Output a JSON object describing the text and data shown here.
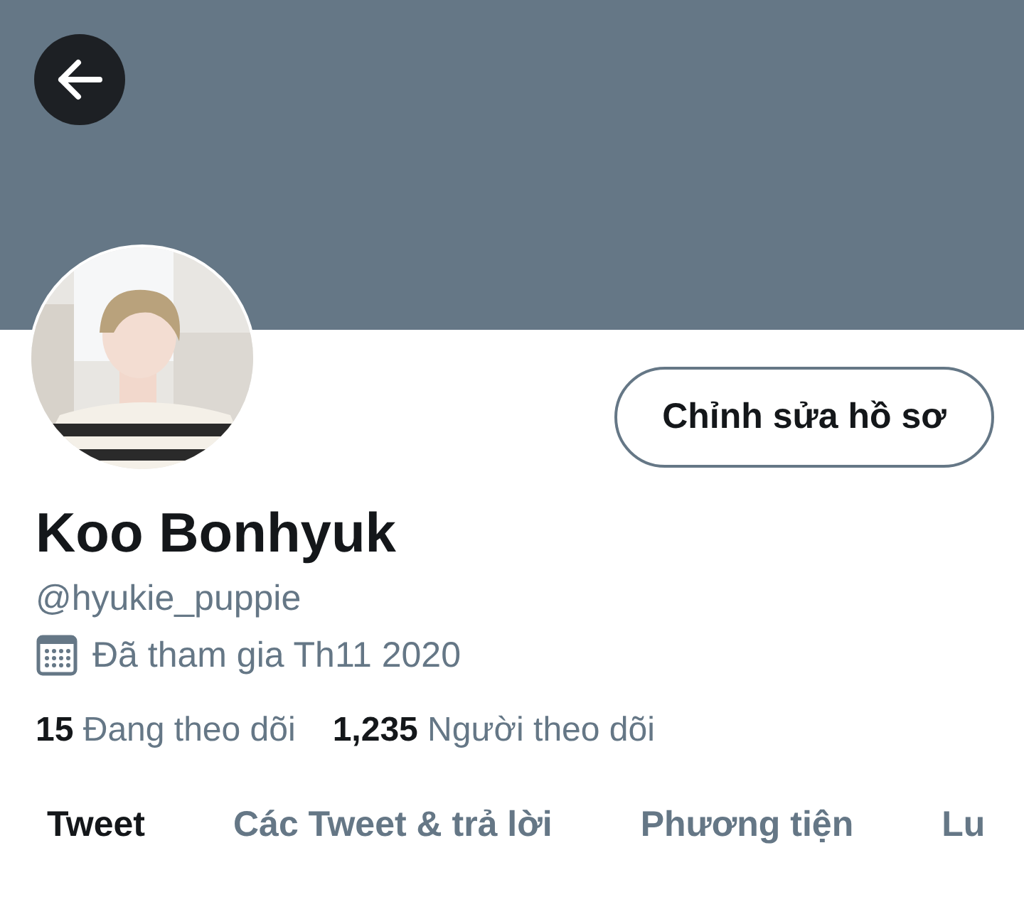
{
  "profile": {
    "name": "Koo Bonhyuk",
    "handle": "@hyukie_puppie",
    "joined": "Đã tham gia Th11 2020"
  },
  "edit_button": {
    "label": "Chỉnh sửa hồ sơ"
  },
  "stats": [
    {
      "count": "15",
      "label": "Đang theo dõi"
    },
    {
      "count": "1,235",
      "label": "Người theo dõi"
    }
  ],
  "tabs": [
    {
      "label": "Tweet",
      "selected": true
    },
    {
      "label": "Các Tweet & trả lời",
      "selected": false
    },
    {
      "label": "Phương tiện",
      "selected": false
    },
    {
      "label": "Lu",
      "selected": false
    }
  ]
}
